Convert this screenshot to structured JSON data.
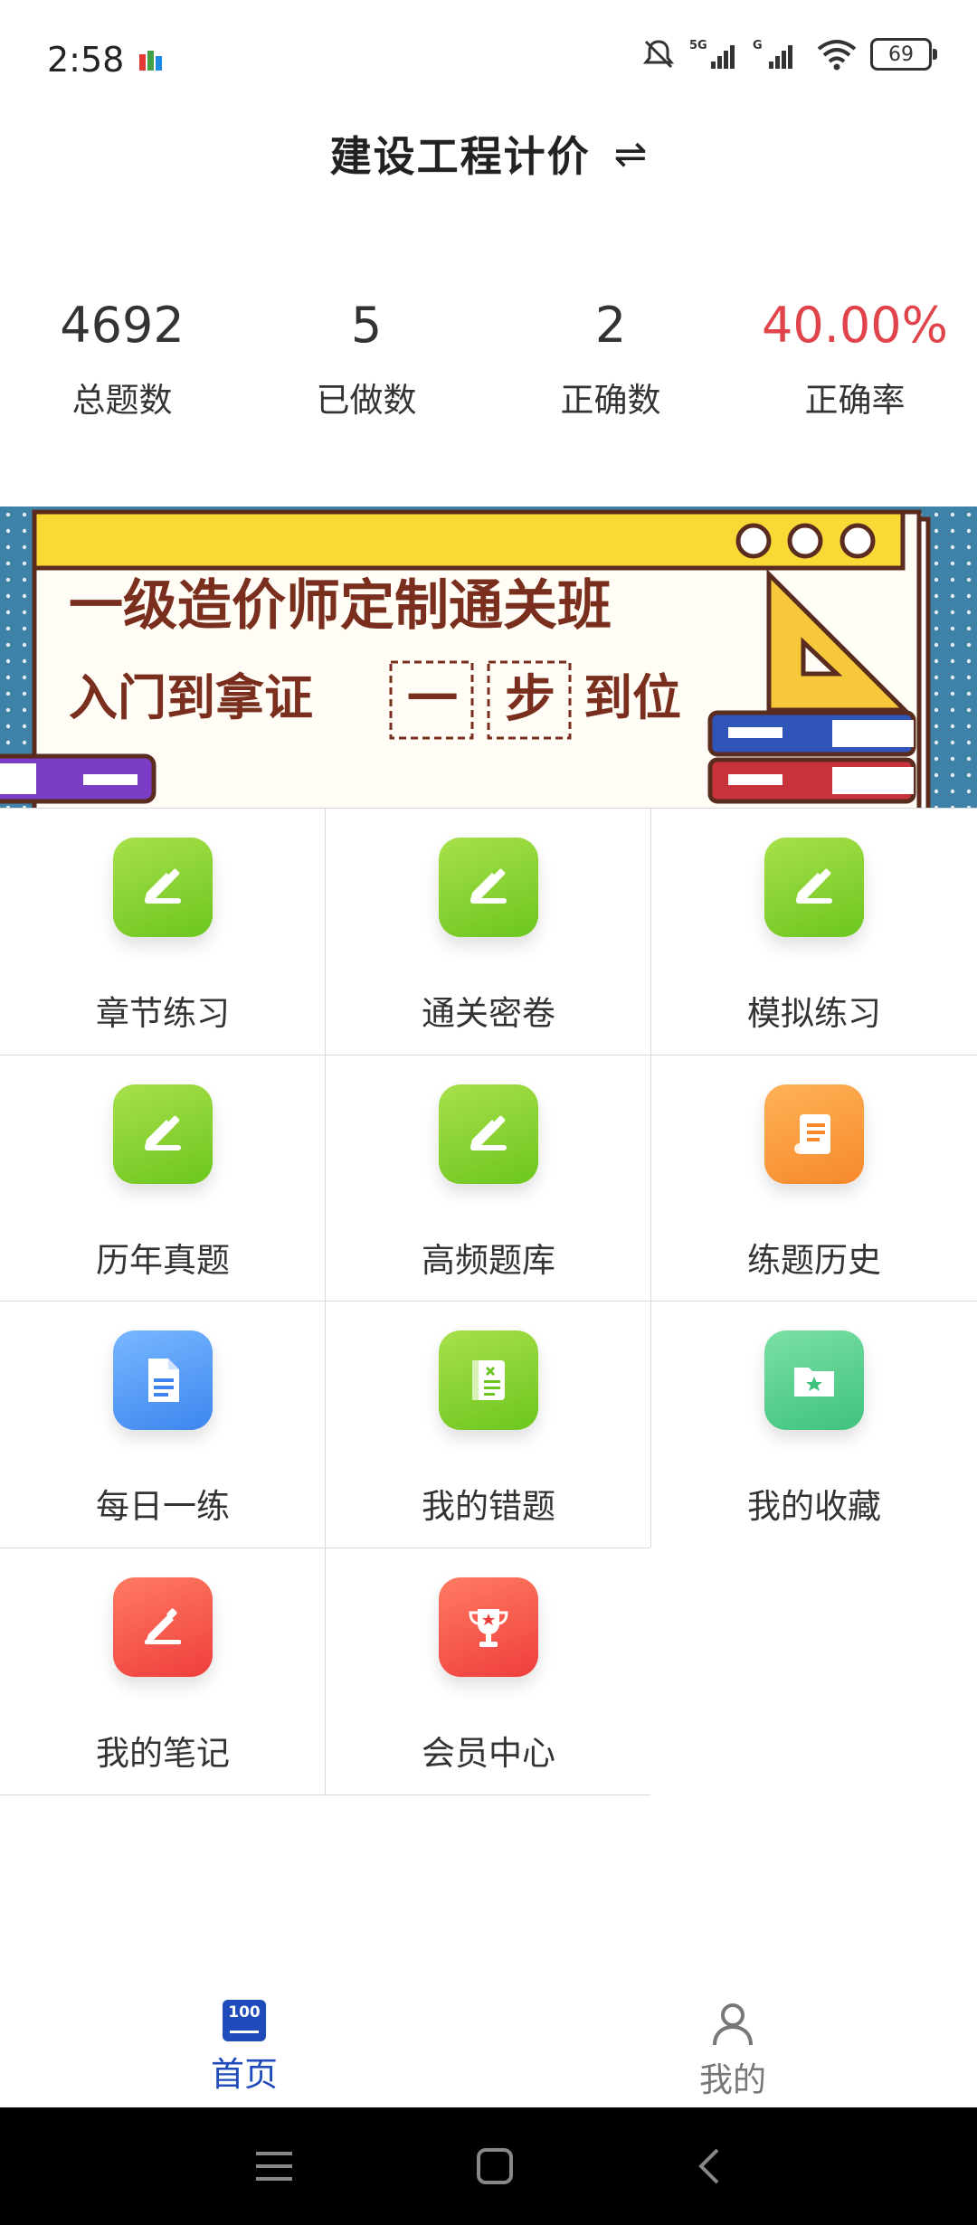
{
  "status_bar": {
    "time": "2:58",
    "battery": "69"
  },
  "header": {
    "title": "建设工程计价",
    "switch_symbol": "⇌"
  },
  "stats": [
    {
      "value": "4692",
      "label": "总题数"
    },
    {
      "value": "5",
      "label": "已做数"
    },
    {
      "value": "2",
      "label": "正确数"
    },
    {
      "value": "40.00%",
      "label": "正确率"
    }
  ],
  "banner": {
    "line1": "一级造价师定制通关班",
    "line2_prefix": "入门到拿证",
    "box1": "一",
    "box2": "步",
    "line2_suffix": "到位"
  },
  "grid": [
    {
      "label": "章节练习",
      "icon": "edit-icon"
    },
    {
      "label": "通关密卷",
      "icon": "edit-icon"
    },
    {
      "label": "模拟练习",
      "icon": "edit-icon"
    },
    {
      "label": "历年真题",
      "icon": "edit-icon"
    },
    {
      "label": "高频题库",
      "icon": "edit-icon"
    },
    {
      "label": "练题历史",
      "icon": "scroll-icon"
    },
    {
      "label": "每日一练",
      "icon": "document-icon"
    },
    {
      "label": "我的错题",
      "icon": "notebook-icon"
    },
    {
      "label": "我的收藏",
      "icon": "star-folder-icon"
    },
    {
      "label": "我的笔记",
      "icon": "pen-icon"
    },
    {
      "label": "会员中心",
      "icon": "trophy-icon"
    }
  ],
  "bottom_nav": {
    "home": {
      "label": "首页",
      "badge": "100"
    },
    "mine": {
      "label": "我的"
    }
  },
  "colors": {
    "accent_red": "#e0434a",
    "nav_active": "#1f4bbb",
    "icon_green": "#7fd02e"
  }
}
